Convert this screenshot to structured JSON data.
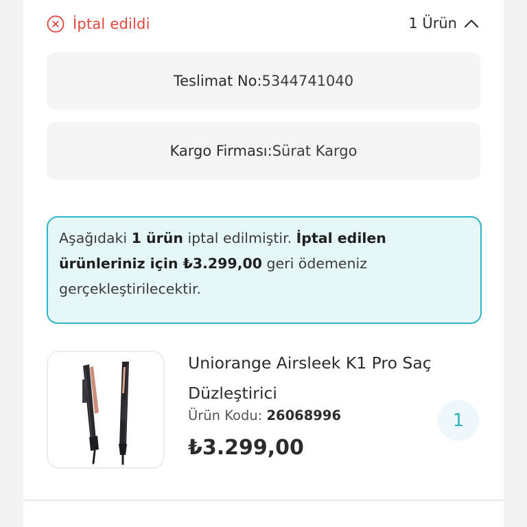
{
  "order": {
    "status_label": "İptal edildi",
    "product_count_label": "1 Ürün",
    "delivery_label": "Teslimat No:",
    "delivery_number": "5344741040",
    "cargo_label": "Kargo Firması:",
    "cargo_company": "Sürat Kargo"
  },
  "notice": {
    "part1": "Aşağıdaki ",
    "bold1": "1 ürün",
    "part2": " iptal edilmiştir. ",
    "bold2": "İptal edilen ürünleriniz için ₺3.299,00",
    "part3": " geri ödemeniz gerçekleştirilecektir."
  },
  "product": {
    "name": "Uniorange Airsleek K1 Pro Saç Düzleştirici",
    "code_label": "Ürün Kodu: ",
    "code": "26068996",
    "price": "₺3.299,00",
    "quantity": "1"
  },
  "icons": {
    "status": "cancel-circle-icon",
    "toggle": "chevron-up-icon"
  },
  "colors": {
    "cancel_red": "#e0463c",
    "accent_teal": "#2fb3c3",
    "notice_bg": "#e6f7f8"
  }
}
